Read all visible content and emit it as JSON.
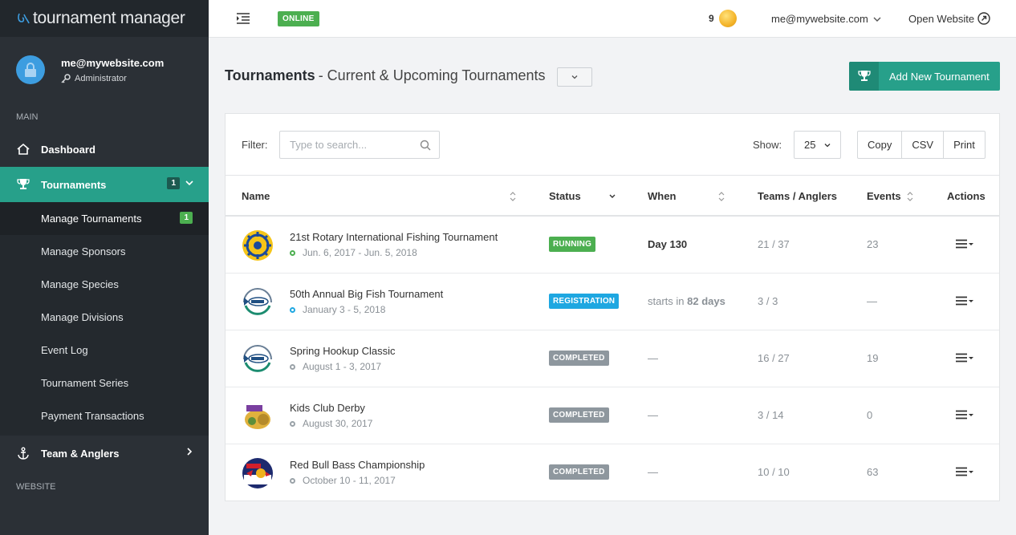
{
  "brand": {
    "name": "tournament manager"
  },
  "user": {
    "email": "me@mywebsite.com",
    "role": "Administrator"
  },
  "sidebar": {
    "main_label": "MAIN",
    "website_label": "WEBSITE",
    "items": [
      {
        "label": "Dashboard",
        "icon": "home-icon"
      },
      {
        "label": "Tournaments",
        "icon": "trophy-icon",
        "badge": "1",
        "active": true
      },
      {
        "label": "Team & Anglers",
        "icon": "anchor-icon"
      }
    ],
    "sub_items": [
      {
        "label": "Manage Tournaments",
        "badge": "1",
        "active": true
      },
      {
        "label": "Manage Sponsors"
      },
      {
        "label": "Manage Species"
      },
      {
        "label": "Manage Divisions"
      },
      {
        "label": "Event Log"
      },
      {
        "label": "Tournament Series"
      },
      {
        "label": "Payment Transactions"
      }
    ]
  },
  "topbar": {
    "status": "ONLINE",
    "coins": "9",
    "account": "me@mywebsite.com",
    "open_website": "Open Website"
  },
  "page": {
    "title": "Tournaments",
    "subtitle": "- Current & Upcoming Tournaments",
    "add_button": "Add New Tournament"
  },
  "toolbar": {
    "filter_label": "Filter:",
    "search_placeholder": "Type to search...",
    "show_label": "Show:",
    "show_value": "25",
    "copy": "Copy",
    "csv": "CSV",
    "print": "Print"
  },
  "table": {
    "columns": [
      "Name",
      "Status",
      "When",
      "Teams / Anglers",
      "Events",
      "Actions"
    ],
    "rows": [
      {
        "name": "21st Rotary International Fishing Tournament",
        "dates": "Jun. 6, 2017 - Jun. 5, 2018",
        "status": "RUNNING",
        "status_color": "#4caf50",
        "dot_color": "#4caf50",
        "when_prefix": "",
        "when_bold": "Day 130",
        "teams": "21 / 37",
        "events": "23",
        "logo": "rotary"
      },
      {
        "name": "50th Annual Big Fish Tournament",
        "dates": "January 3 - 5, 2018",
        "status": "REGISTRATION",
        "status_color": "#1ea7e1",
        "dot_color": "#1ea7e1",
        "when_prefix": "starts in ",
        "when_bold": "82 days",
        "teams": "3 / 3",
        "events": "—",
        "logo": "fish"
      },
      {
        "name": "Spring Hookup Classic",
        "dates": "August 1 - 3, 2017",
        "status": "COMPLETED",
        "status_color": "#8e979e",
        "dot_color": "#9aa2a8",
        "when_prefix": "—",
        "when_bold": "",
        "teams": "16 / 27",
        "events": "19",
        "logo": "fish"
      },
      {
        "name": "Kids Club Derby",
        "dates": "August 30, 2017",
        "status": "COMPLETED",
        "status_color": "#8e979e",
        "dot_color": "#9aa2a8",
        "when_prefix": "—",
        "when_bold": "",
        "teams": "3 / 14",
        "events": "0",
        "logo": "kids"
      },
      {
        "name": "Red Bull Bass Championship",
        "dates": "October 10 - 11, 2017",
        "status": "COMPLETED",
        "status_color": "#8e979e",
        "dot_color": "#9aa2a8",
        "when_prefix": "—",
        "when_bold": "",
        "teams": "10 / 10",
        "events": "63",
        "logo": "redbull"
      }
    ]
  }
}
